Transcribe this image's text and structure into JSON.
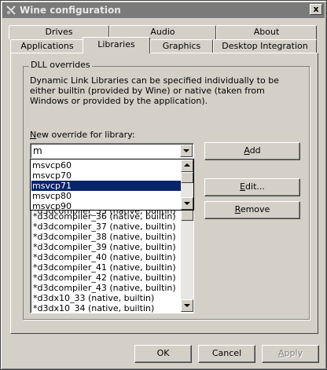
{
  "window": {
    "title": "Wine configuration",
    "close_label": "x"
  },
  "tabs_top": [
    {
      "label": "Drives"
    },
    {
      "label": "Audio"
    },
    {
      "label": "About"
    }
  ],
  "tabs_bottom": [
    {
      "label": "Applications"
    },
    {
      "label": "Libraries"
    },
    {
      "label": "Graphics"
    },
    {
      "label": "Desktop Integration"
    }
  ],
  "active_tab": "Libraries",
  "group": {
    "title": "DLL overrides",
    "description": "Dynamic Link Libraries can be specified individually to be either builtin (provided by Wine) or native (taken from Windows or provided by the application)."
  },
  "new_override": {
    "label_pre": "",
    "label_ul": "N",
    "label_post": "ew override for library:",
    "value": "m"
  },
  "dropdown_options": [
    {
      "label": "msvcp60",
      "selected": false
    },
    {
      "label": "msvcp70",
      "selected": false
    },
    {
      "label": "msvcp71",
      "selected": true
    },
    {
      "label": "msvcp80",
      "selected": false
    },
    {
      "label": "msvcp90",
      "selected": false
    }
  ],
  "overrides": [
    "*d3dcompiler_35 (native, builtin)",
    "*d3dcompiler_36 (native, builtin)",
    "*d3dcompiler_37 (native, builtin)",
    "*d3dcompiler_38 (native, builtin)",
    "*d3dcompiler_39 (native, builtin)",
    "*d3dcompiler_40 (native, builtin)",
    "*d3dcompiler_41 (native, builtin)",
    "*d3dcompiler_42 (native, builtin)",
    "*d3dcompiler_43 (native, builtin)",
    "*d3dx10_33 (native, builtin)",
    "*d3dx10_34 (native, builtin)"
  ],
  "buttons": {
    "add": {
      "ul": "A",
      "rest": "dd"
    },
    "edit": {
      "ul": "E",
      "rest": "dit..."
    },
    "remove": {
      "ul": "R",
      "rest": "emove"
    },
    "ok": "OK",
    "cancel": "Cancel",
    "apply": {
      "ul": "A",
      "rest": "pply"
    }
  },
  "colors": {
    "selection": "#0a246a",
    "face": "#d4d0c8",
    "titlebar": "#7a7a7a"
  }
}
